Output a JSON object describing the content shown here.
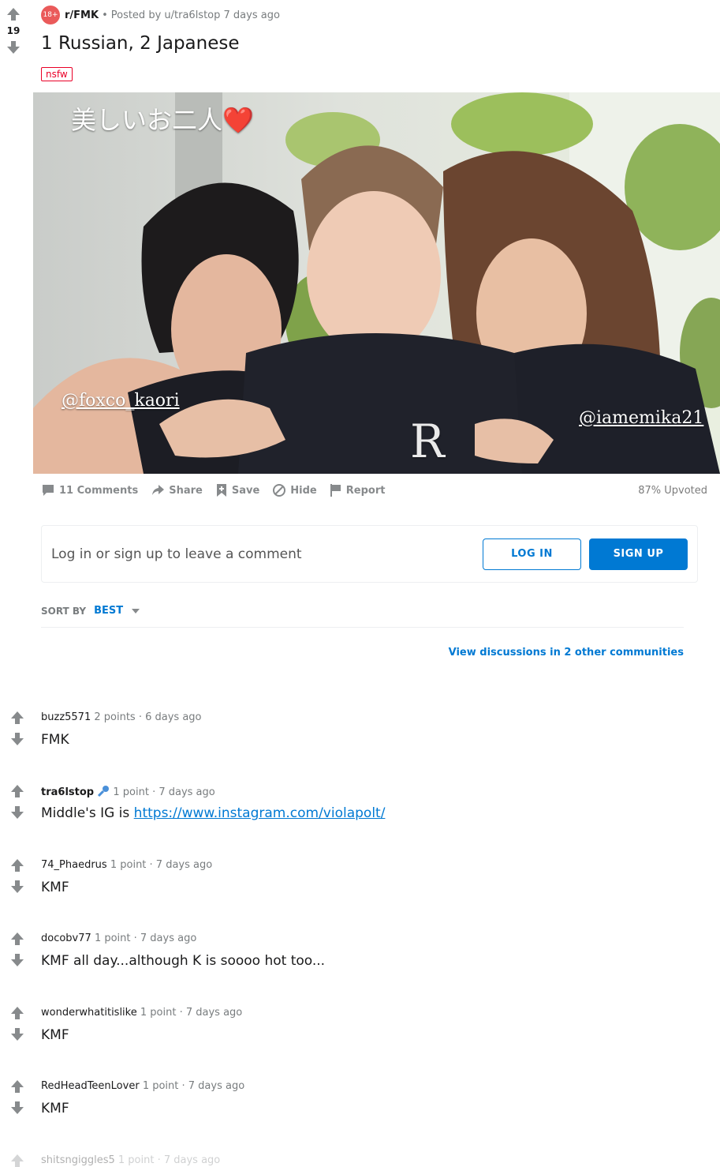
{
  "post": {
    "score": "19",
    "subreddit_icon": "18+",
    "subreddit": "r/FMK",
    "dot": "•",
    "posted_by": "Posted by u/tra6lstop 7 days ago",
    "title": "1 Russian, 2 Japanese",
    "tag": "nsfw",
    "image": {
      "caption_top": "美しいお二人❤️",
      "caption_left": "@foxco_kaori",
      "caption_right": "@iamemika21",
      "shirt_letter": "R"
    }
  },
  "actions": {
    "comments": "11 Comments",
    "share": "Share",
    "save": "Save",
    "hide": "Hide",
    "report": "Report",
    "upvoted": "87% Upvoted"
  },
  "login": {
    "prompt": "Log in or sign up to leave a comment",
    "login_label": "LOG IN",
    "signup_label": "SIGN UP"
  },
  "sort": {
    "label": "SORT BY",
    "value": "BEST"
  },
  "view_discussions": "View discussions in 2 other communities",
  "comments": [
    {
      "author": "buzz5571",
      "meta": "2 points · 6 days ago",
      "body": "FMK"
    },
    {
      "author": "tra6lstop",
      "meta": "1 point · 7 days ago",
      "body_prefix": "Middle's IG is ",
      "link": "https://www.instagram.com/violapolt/"
    },
    {
      "author": "74_Phaedrus",
      "meta": "1 point · 7 days ago",
      "body": "KMF"
    },
    {
      "author": "docobv77",
      "meta": "1 point · 7 days ago",
      "body": "KMF all day...although K is soooo hot too..."
    },
    {
      "author": "wonderwhatitislike",
      "meta": "1 point · 7 days ago",
      "body": "KMF"
    },
    {
      "author": "RedHeadTeenLover",
      "meta": "1 point · 7 days ago",
      "body": "KMF"
    },
    {
      "author": "shitsngiggles5",
      "meta": "1 point · 7 days ago",
      "body": ""
    }
  ],
  "colors": {
    "accent": "#0079d3",
    "nsfw": "#ea0027",
    "subreddit_icon": "#ea5a5a",
    "muted": "#878a8c"
  }
}
